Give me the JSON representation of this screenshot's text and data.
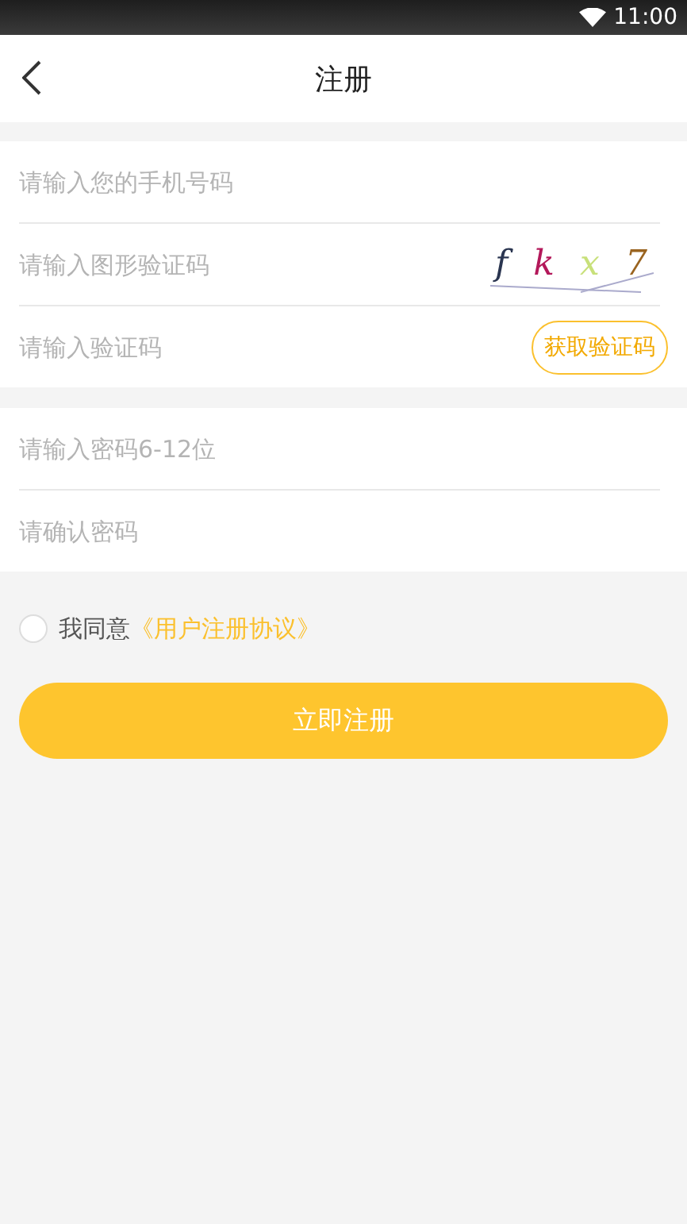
{
  "status_bar": {
    "time": "11:00"
  },
  "header": {
    "title": "注册"
  },
  "group_1": [
    {
      "kind": "text",
      "placeholder": "请输入您的手机号码"
    },
    {
      "kind": "captcha",
      "placeholder": "请输入图形验证码",
      "captcha_chars": [
        {
          "char": "f",
          "color": "#2a3550"
        },
        {
          "char": "k",
          "color": "#b3185a"
        },
        {
          "char": "x",
          "color": "#c8e07a"
        },
        {
          "char": "7",
          "color": "#9a6420"
        }
      ]
    },
    {
      "kind": "code",
      "placeholder": "请输入验证码",
      "button": "获取验证码"
    }
  ],
  "group_2": [
    {
      "kind": "text",
      "placeholder": "请输入密码6-12位"
    },
    {
      "kind": "text",
      "placeholder": "请确认密码"
    }
  ],
  "agreement": {
    "checked": false,
    "text": "我同意",
    "link": "《用户注册协议》"
  },
  "submit_button": "立即注册"
}
